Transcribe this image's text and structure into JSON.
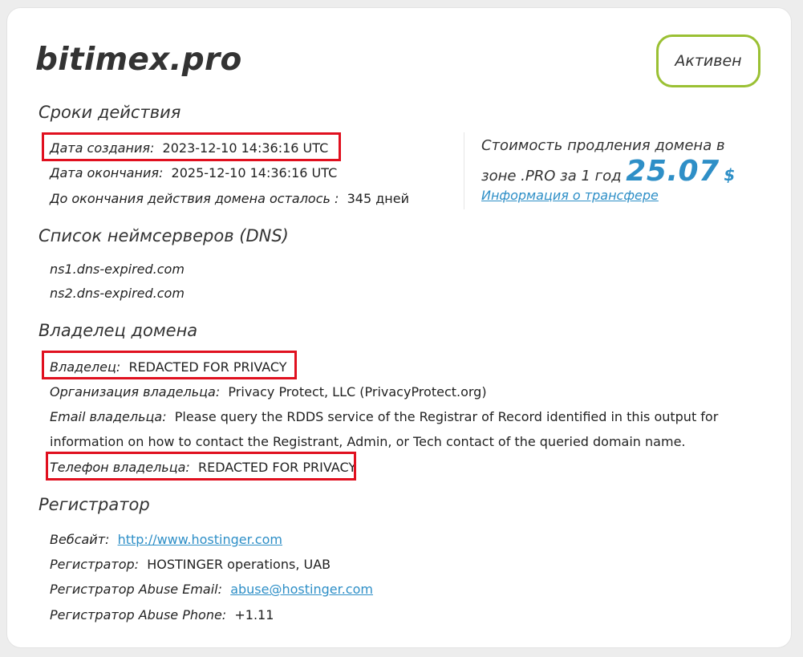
{
  "domain": "bitimex.pro",
  "status": "Активен",
  "validity": {
    "title": "Сроки действия",
    "created_label": "Дата создания:",
    "created_value": "2023-12-10 14:36:16 UTC",
    "expires_label": "Дата окончания:",
    "expires_value": "2025-12-10 14:36:16 UTC",
    "remaining_label": "До окончания действия домена осталось :",
    "remaining_value": "345 дней"
  },
  "renewal": {
    "text_line1": "Стоимость продления домена в",
    "text_line2": "зоне .PRO за 1 год",
    "price": "25.07",
    "currency": "$",
    "transfer_link": "Информация о трансфере"
  },
  "dns": {
    "title": "Список неймсерверов (DNS)",
    "servers": [
      "ns1.dns-expired.com",
      "ns2.dns-expired.com"
    ]
  },
  "owner": {
    "title": "Владелец домена",
    "owner_label": "Владелец:",
    "owner_value": "REDACTED FOR PRIVACY",
    "org_label": "Организация владельца:",
    "org_value": "Privacy Protect, LLC (PrivacyProtect.org)",
    "email_label": "Email владельца:",
    "email_value_line1": "Please query the RDDS service of the Registrar of Record identified in this output for",
    "email_value_line2": "information on how to contact the Registrant, Admin, or Tech contact of the queried domain name.",
    "phone_label": "Телефон владельца:",
    "phone_value": "REDACTED FOR PRIVACY"
  },
  "registrar": {
    "title": "Регистратор",
    "website_label": "Вебсайт:",
    "website_value": "http://www.hostinger.com",
    "name_label": "Регистратор:",
    "name_value": "HOSTINGER operations, UAB",
    "abuse_email_label": "Регистратор Abuse Email:",
    "abuse_email_value": "abuse@hostinger.com",
    "abuse_phone_label": "Регистратор Abuse Phone:",
    "abuse_phone_value": "+1.11"
  },
  "colors": {
    "accent_blue": "#2e8fc7",
    "status_green": "#9ac033",
    "highlight_red": "#e0101f"
  }
}
